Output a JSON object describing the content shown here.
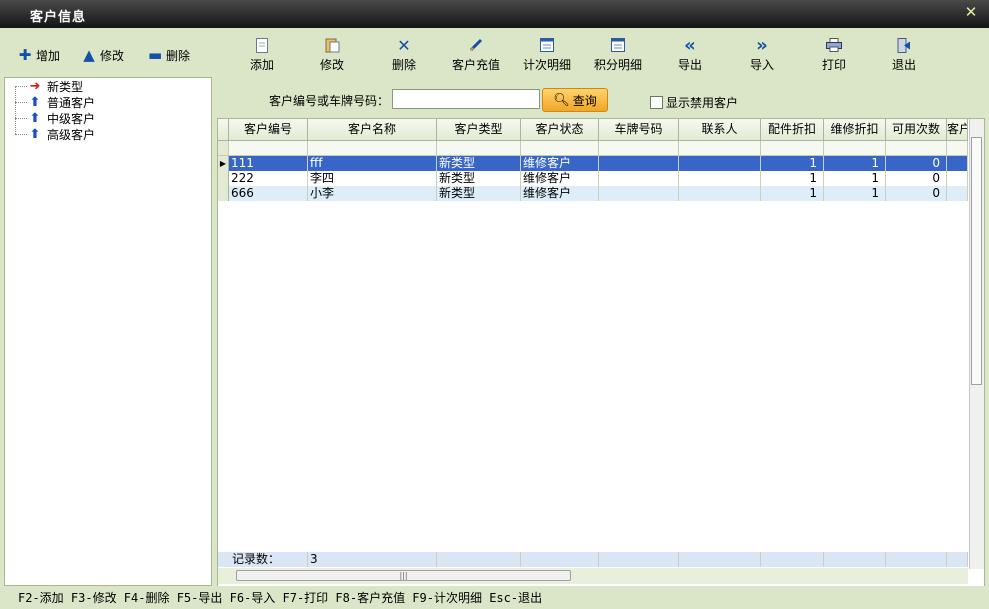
{
  "window": {
    "title": "客户信息",
    "close_icon": "close-icon"
  },
  "leftbar": {
    "add": "增加",
    "edit": "修改",
    "delete": "删除"
  },
  "toolbar": [
    {
      "label": "添加",
      "icon": "document-icon"
    },
    {
      "label": "修改",
      "icon": "clipboard-icon"
    },
    {
      "label": "删除",
      "icon": "x-icon"
    },
    {
      "label": "客户充值",
      "icon": "pen-icon"
    },
    {
      "label": "计次明细",
      "icon": "calendar-icon"
    },
    {
      "label": "积分明细",
      "icon": "calendar-icon"
    },
    {
      "label": "导出",
      "icon": "double-left-icon"
    },
    {
      "label": "导入",
      "icon": "double-right-icon"
    },
    {
      "label": "打印",
      "icon": "printer-icon"
    },
    {
      "label": "退出",
      "icon": "exit-icon"
    }
  ],
  "tree": {
    "items": [
      {
        "label": "新类型",
        "icon": "red-arrow-right-icon"
      },
      {
        "label": "普通客户",
        "icon": "blue-arrow-up-icon"
      },
      {
        "label": "中级客户",
        "icon": "blue-arrow-up-icon"
      },
      {
        "label": "高级客户",
        "icon": "blue-arrow-up-icon"
      }
    ]
  },
  "search": {
    "label": "客户编号或车牌号码：",
    "value": "",
    "button": "查询",
    "checkbox": "显示禁用客户"
  },
  "grid": {
    "columns": [
      "客户编号",
      "客户名称",
      "客户类型",
      "客户状态",
      "车牌号码",
      "联系人",
      "配件折扣",
      "维修折扣",
      "可用次数",
      "客户"
    ],
    "rows": [
      [
        "111",
        "fff",
        "新类型",
        "维修客户",
        "",
        "",
        "1",
        "1",
        "0",
        ""
      ],
      [
        "222",
        "李四",
        "新类型",
        "维修客户",
        "",
        "",
        "1",
        "1",
        "0",
        ""
      ],
      [
        "666",
        "小李",
        "新类型",
        "维修客户",
        "",
        "",
        "1",
        "1",
        "0",
        ""
      ]
    ],
    "footer_label": "记录数：",
    "footer_value": "3"
  },
  "status": {
    "text": "F2-添加 F3-修改 F4-删除 F5-导出 F6-导入 F7-打印 F8-客户充值 F9-计次明细 Esc-退出"
  },
  "colors": {
    "selected_row": "#3766c8",
    "alt_row": "#ddeef8",
    "panel_bg": "#dbe6c8",
    "accent_button": "#f2a52a"
  }
}
